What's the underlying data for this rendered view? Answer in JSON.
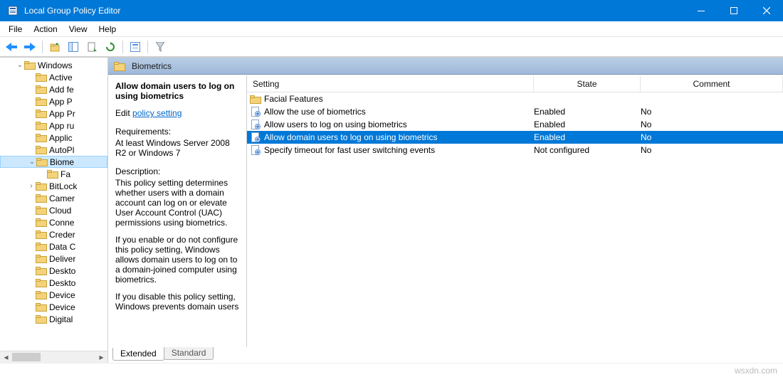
{
  "window": {
    "title": "Local Group Policy Editor"
  },
  "menu": {
    "items": [
      "File",
      "Action",
      "View",
      "Help"
    ]
  },
  "tree": {
    "root_label": "Windows",
    "items": [
      "Active",
      "Add fe",
      "App P",
      "App Pr",
      "App ru",
      "Applic",
      "AutoPl"
    ],
    "biometrics_label": "Biome",
    "biometrics_child": "Fa",
    "items2": [
      "BitLock",
      "Camer",
      "Cloud",
      "Conne",
      "Creder",
      "Data C",
      "Deliver",
      "Deskto",
      "Deskto",
      "Device",
      "Device",
      "Digital"
    ]
  },
  "category": {
    "label": "Biometrics"
  },
  "description": {
    "title": "Allow domain users to log on using biometrics",
    "edit_prefix": "Edit ",
    "edit_link": "policy setting",
    "req_label": "Requirements:",
    "req_text": "At least Windows Server 2008 R2 or Windows 7",
    "desc_label": "Description:",
    "para1": "This policy setting determines whether users with a domain account can log on or elevate User Account Control (UAC) permissions using biometrics.",
    "para2": "If you enable or do not configure this policy setting, Windows allows domain users to log on to a domain-joined computer using biometrics.",
    "para3": "If you disable this policy setting, Windows prevents domain users"
  },
  "list": {
    "columns": {
      "setting": "Setting",
      "state": "State",
      "comment": "Comment"
    },
    "rows": [
      {
        "type": "folder",
        "name": "Facial Features",
        "state": "",
        "comment": ""
      },
      {
        "type": "setting",
        "name": "Allow the use of biometrics",
        "state": "Enabled",
        "comment": "No"
      },
      {
        "type": "setting",
        "name": "Allow users to log on using biometrics",
        "state": "Enabled",
        "comment": "No"
      },
      {
        "type": "setting",
        "name": "Allow domain users to log on using biometrics",
        "state": "Enabled",
        "comment": "No",
        "selected": true
      },
      {
        "type": "setting",
        "name": "Specify timeout for fast user switching events",
        "state": "Not configured",
        "comment": "No"
      }
    ]
  },
  "tabs": {
    "extended": "Extended",
    "standard": "Standard"
  },
  "watermark": "wsxdn.com"
}
